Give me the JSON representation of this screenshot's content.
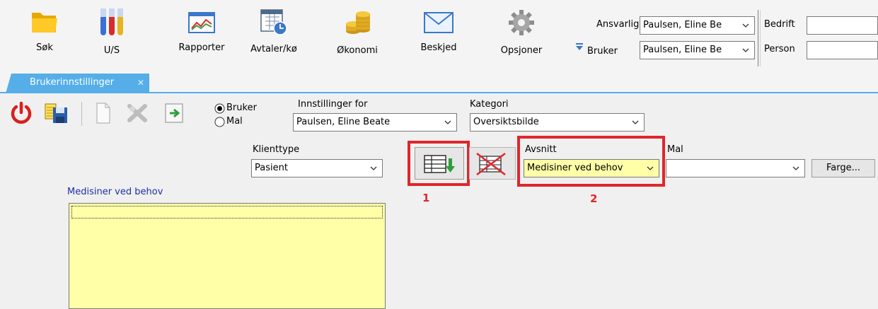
{
  "toolbar": {
    "items": [
      {
        "label": "Søk",
        "icon": "folder-icon"
      },
      {
        "label": "U/S",
        "icon": "test-tubes-icon"
      },
      {
        "label": "Rapporter",
        "icon": "chart-icon"
      },
      {
        "label": "Avtaler/kø",
        "icon": "calendar-clock-icon"
      },
      {
        "label": "Økonomi",
        "icon": "coins-icon"
      },
      {
        "label": "Beskjed",
        "icon": "envelope-icon"
      },
      {
        "label": "Opsjoner",
        "icon": "gear-icon"
      }
    ],
    "ansvarlig_label": "Ansvarlig",
    "ansvarlig_value": "Paulsen, Eline Be",
    "bruker_label": "Bruker",
    "bruker_value": "Paulsen, Eline Be",
    "bedrift_label": "Bedrift",
    "person_label": "Person"
  },
  "tab": {
    "label": "Brukerinnstillinger"
  },
  "radio": {
    "bruker": "Bruker",
    "mal": "Mal",
    "selected": "Bruker"
  },
  "fields": {
    "innstillinger_for_label": "Innstillinger for",
    "innstillinger_for_value": "Paulsen, Eline Beate",
    "kategori_label": "Kategori",
    "kategori_value": "Oversiktsbilde",
    "klienttype_label": "Klienttype",
    "klienttype_value": "Pasient",
    "avsnitt_label": "Avsnitt",
    "avsnitt_value": "Medisiner ved behov",
    "mal_label": "Mal",
    "mal_value": "",
    "farge_button": "Farge..."
  },
  "markers": {
    "one": "1",
    "two": "2"
  },
  "section": {
    "title": "Medisiner ved behov"
  },
  "colors": {
    "tab_accent": "#55aee8",
    "highlight": "#e0262c",
    "notes_bg": "#ffffa8",
    "section_title": "#1f2fa3",
    "avsnitt_bg": "#ffffa8"
  }
}
